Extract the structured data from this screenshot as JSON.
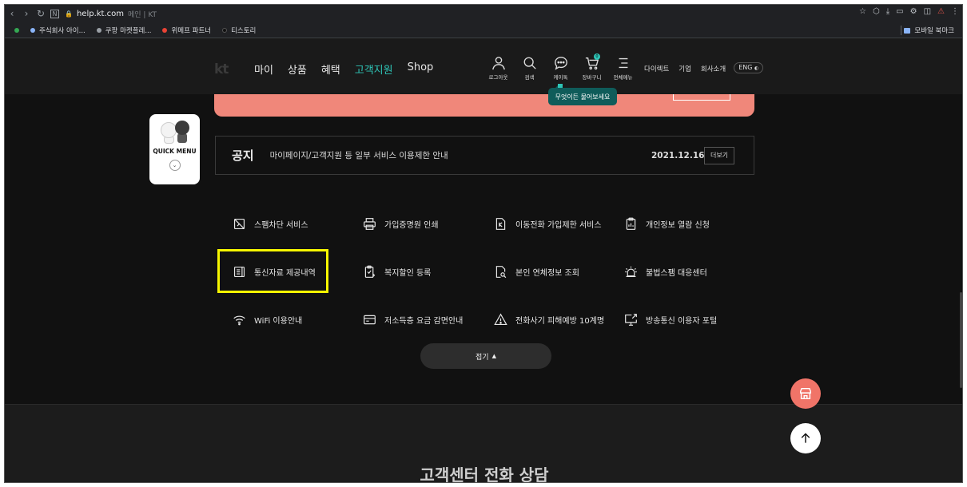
{
  "browser": {
    "url": "help.kt.com",
    "url_sub": "메인 | KT",
    "bookmarks": [
      {
        "label": "주식회사 아이...",
        "color": "#34a853"
      },
      {
        "label": "쿠팡 마켓플레...",
        "color": "#9aa0a6"
      },
      {
        "label": "위메프 파트너",
        "color": "#ea4335"
      },
      {
        "label": "티스토리",
        "color": "#111111"
      }
    ],
    "mobile_bookmarks": "모바일 북마크"
  },
  "header": {
    "logo": "kt",
    "gnb": [
      {
        "label": "마이",
        "active": false
      },
      {
        "label": "상품",
        "active": false
      },
      {
        "label": "혜택",
        "active": false
      },
      {
        "label": "고객지원",
        "active": true
      },
      {
        "label": "Shop",
        "active": false
      }
    ],
    "util": [
      {
        "label": "로그아웃",
        "icon": "person-icon"
      },
      {
        "label": "검색",
        "icon": "search-icon"
      },
      {
        "label": "케이톡",
        "icon": "chat-icon"
      },
      {
        "label": "장바구니",
        "icon": "cart-icon",
        "badge": "0"
      },
      {
        "label": "전체메뉴",
        "icon": "menu-icon"
      }
    ],
    "links": [
      "다이렉트",
      "기업",
      "회사소개"
    ],
    "lang": "ENG",
    "chat_tooltip": "무엇이든 물어보세요"
  },
  "quick_menu": {
    "label": "QUICK MENU"
  },
  "notice": {
    "label": "공지",
    "text": "마이페이지/고객지원 등 일부 서비스 이용제한 안내",
    "date": "2021.12.16",
    "more": "더보기"
  },
  "services": [
    {
      "label": "스팸차단 서비스",
      "icon": "spam-block-icon"
    },
    {
      "label": "가입증명원 인쇄",
      "icon": "printer-icon"
    },
    {
      "label": "이동전화 가입제한 서비스",
      "icon": "phone-restrict-icon"
    },
    {
      "label": "개인정보 열람 신청",
      "icon": "clipboard-icon"
    },
    {
      "label": "통신자료 제공내역",
      "icon": "document-icon"
    },
    {
      "label": "복지할인 등록",
      "icon": "welfare-icon"
    },
    {
      "label": "본인 연체정보 조회",
      "icon": "doc-search-icon"
    },
    {
      "label": "불법스팸 대응센터",
      "icon": "siren-icon"
    },
    {
      "label": "WiFi 이용안내",
      "icon": "wifi-icon"
    },
    {
      "label": "저소득층 요금 감면안내",
      "icon": "card-icon"
    },
    {
      "label": "전화사기 피해예방 10계명",
      "icon": "warning-icon"
    },
    {
      "label": "방송통신 이용자 포털",
      "icon": "monitor-icon"
    }
  ],
  "collapse": {
    "label": "접기",
    "icon": "chevron-up-icon"
  },
  "footer": {
    "center_title": "고객센터 전화 상담"
  }
}
